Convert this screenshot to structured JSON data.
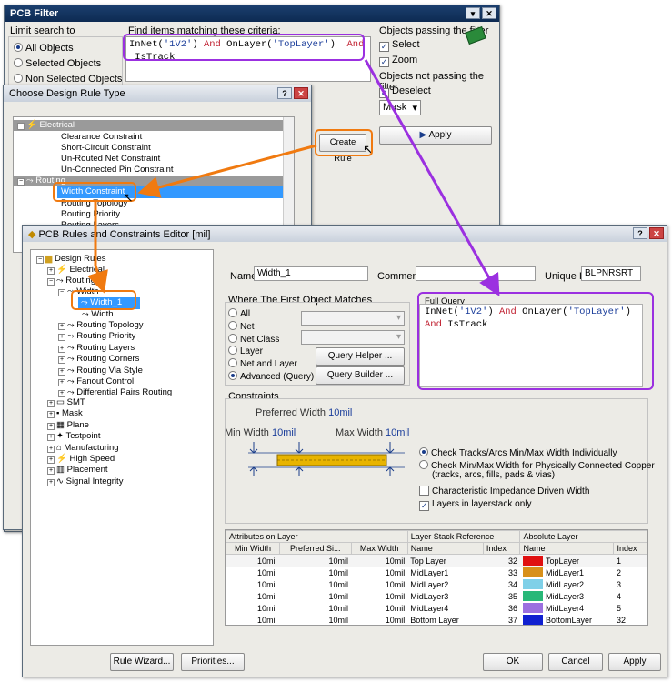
{
  "pcb_filter": {
    "title": "PCB Filter",
    "limit_label": "Limit search to",
    "options": [
      "All Objects",
      "Selected Objects",
      "Non Selected Objects"
    ],
    "find_label": "Find items matching these criteria:",
    "query_parts": [
      {
        "t": "InNet(",
        "c": "n"
      },
      {
        "t": "'1V2'",
        "c": "s"
      },
      {
        "t": ") ",
        "c": "n"
      },
      {
        "t": "And",
        "c": "k"
      },
      {
        "t": " OnLayer(",
        "c": "n"
      },
      {
        "t": "'TopLayer'",
        "c": "s"
      },
      {
        "t": ")  ",
        "c": "n"
      },
      {
        "t": "And",
        "c": "k"
      },
      {
        "t": " IsTrack",
        "c": "n"
      }
    ],
    "passing_label": "Objects passing the filter",
    "select": "Select",
    "zoom": "Zoom",
    "not_passing_label": "Objects not passing the filter",
    "deselect": "Deselect",
    "mask": "Mask",
    "apply": "Apply"
  },
  "rule_type": {
    "title": "Choose Design Rule Type",
    "electrical": "Electrical",
    "electrical_items": [
      "Clearance Constraint",
      "Short-Circuit Constraint",
      "Un-Routed Net Constraint",
      "Un-Connected Pin Constraint"
    ],
    "routing": "Routing",
    "routing_items": [
      "Width Constraint",
      "Routing Topology",
      "Routing Priority",
      "Routing Layers"
    ],
    "create_rule": "Create Rule"
  },
  "editor": {
    "title": "PCB Rules and Constraints Editor [mil]",
    "tree": {
      "root": "Design Rules",
      "electrical": "Electrical",
      "routing": "Routing",
      "width": "Width",
      "width1": "Width_1",
      "width_sub": "Width",
      "routing_items": [
        "Routing Topology",
        "Routing Priority",
        "Routing Layers",
        "Routing Corners",
        "Routing Via Style",
        "Fanout Control",
        "Differential Pairs Routing"
      ],
      "top_items": [
        "SMT",
        "Mask",
        "Plane",
        "Testpoint",
        "Manufacturing",
        "High Speed",
        "Placement",
        "Signal Integrity"
      ]
    },
    "name_label": "Name",
    "name_value": "Width_1",
    "comment_label": "Comment",
    "comment_value": "",
    "uid_label": "Unique ID",
    "uid_value": "BLPNRSRT",
    "where_label": "Where The First Object Matches",
    "where_options": [
      "All",
      "Net",
      "Net Class",
      "Layer",
      "Net and Layer",
      "Advanced (Query)"
    ],
    "query_helper": "Query Helper ...",
    "query_builder": "Query Builder ...",
    "full_query_label": "Full Query",
    "full_query_parts": [
      {
        "t": "InNet(",
        "c": "n"
      },
      {
        "t": "'1V2'",
        "c": "s"
      },
      {
        "t": ") ",
        "c": "n"
      },
      {
        "t": "And",
        "c": "k"
      },
      {
        "t": " OnLayer(",
        "c": "n"
      },
      {
        "t": "'TopLayer'",
        "c": "s"
      },
      {
        "t": ")",
        "c": "n"
      }
    ],
    "full_query_line2_parts": [
      {
        "t": "And",
        "c": "k"
      },
      {
        "t": " IsTrack",
        "c": "n"
      }
    ],
    "constraints_label": "Constraints",
    "preferred_width": "Preferred Width",
    "preferred_val": "10mil",
    "min_width": "Min Width",
    "min_val": "10mil",
    "max_width": "Max Width",
    "max_val": "10mil",
    "check_individual": "Check Tracks/Arcs Min/Max Width Individually",
    "check_physical": "Check Min/Max Width for Physically Connected Copper",
    "check_physical2": "(tracks, arcs, fills, pads & vias)",
    "char_impedance": "Characteristic Impedance Driven Width",
    "layers_only": "Layers in layerstack only",
    "table": {
      "group1": "Attributes on Layer",
      "group2": "Layer Stack Reference",
      "group3": "Absolute Layer",
      "headers": [
        "Min Width",
        "Preferred Si...",
        "Max Width",
        "Name",
        "Index",
        "Name",
        "Index"
      ],
      "rows": [
        [
          "10mil",
          "10mil",
          "10mil",
          "Top Layer",
          "32",
          "TopLayer",
          "1"
        ],
        [
          "10mil",
          "10mil",
          "10mil",
          "MidLayer1",
          "33",
          "MidLayer1",
          "2"
        ],
        [
          "10mil",
          "10mil",
          "10mil",
          "MidLayer2",
          "34",
          "MidLayer2",
          "3"
        ],
        [
          "10mil",
          "10mil",
          "10mil",
          "MidLayer3",
          "35",
          "MidLayer3",
          "4"
        ],
        [
          "10mil",
          "10mil",
          "10mil",
          "MidLayer4",
          "36",
          "MidLayer4",
          "5"
        ],
        [
          "10mil",
          "10mil",
          "10mil",
          "Bottom Layer",
          "37",
          "BottomLayer",
          "32"
        ]
      ],
      "colors": [
        "#e01010",
        "#d8901a",
        "#7fd0e8",
        "#28b878",
        "#9b70e0",
        "#1020d0"
      ]
    },
    "rule_wizard": "Rule Wizard...",
    "priorities": "Priorities...",
    "ok": "OK",
    "cancel": "Cancel",
    "apply": "Apply"
  },
  "colors": {
    "orange": "#f07a10",
    "purple": "#9b30e0",
    "titlebar": "#0d2a52",
    "select": "#3399ff"
  }
}
